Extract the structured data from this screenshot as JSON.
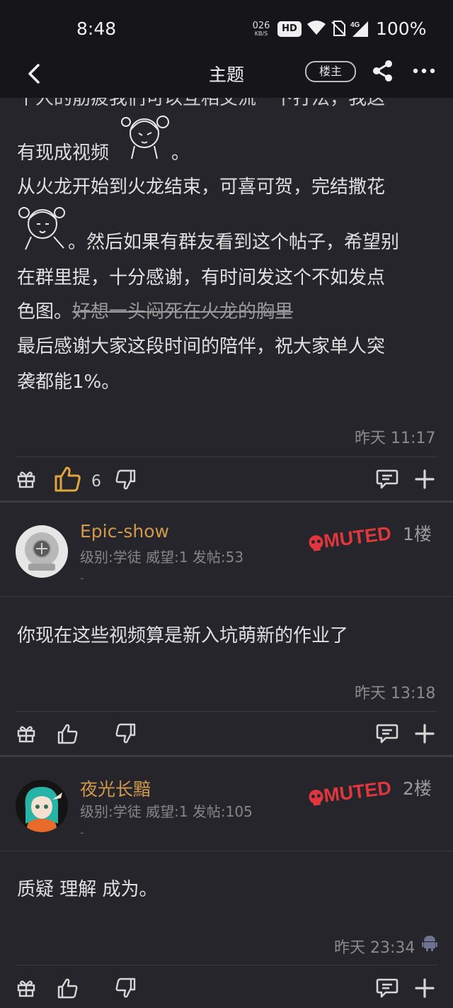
{
  "status_bar": {
    "time": "8:48",
    "net_speed_value": "026",
    "net_speed_unit": "KB/S",
    "hd": "HD",
    "net_type": "4G",
    "battery": "100%"
  },
  "nav": {
    "title": "主题",
    "owner_badge": "楼主"
  },
  "original_post": {
    "cut_line": "个人的筋疲我们可以互相交流一下打法，我这",
    "lines": [
      "有现成视频",
      "从火龙开始到火龙结束，可喜可贺，完结撒花",
      "。然后如果有群友看到这个帖子，希望别",
      "在群里提，十分感谢，有时间发这个不如发点",
      "色图。",
      "好想一头闷死在火龙的胸里",
      "最后感谢大家这段时间的陪伴，祝大家单人突",
      "袭都能1%。"
    ],
    "period": "。",
    "timestamp": "昨天 11:17",
    "like_count": "6"
  },
  "replies": [
    {
      "username": "Epic-show",
      "info": "级别:学徒 威望:1 发帖:53",
      "dash": "-",
      "badge": "MUTED",
      "floor": "1楼",
      "body": "你现在这些视频算是新入坑萌新的作业了",
      "timestamp": "昨天 13:18"
    },
    {
      "username": "夜光长黯",
      "info": "级别:学徒 威望:1 发帖:105",
      "dash": "-",
      "badge": "MUTED",
      "floor": "2楼",
      "body": "质疑 理解 成为。",
      "timestamp": "昨天 23:34"
    }
  ],
  "colors": {
    "accent_like": "#e0a63c",
    "username": "#d19a4b",
    "muted_red": "#e0363d",
    "background": "#25252b"
  }
}
